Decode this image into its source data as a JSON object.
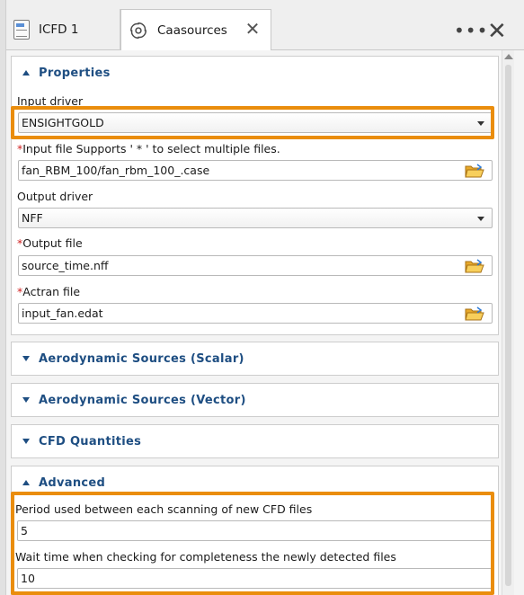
{
  "tabs": [
    {
      "label": "ICFD 1"
    },
    {
      "label": "Caasources"
    }
  ],
  "toolbar": {
    "more": "•••"
  },
  "properties": {
    "title": "Properties",
    "input_driver_label": "Input driver",
    "input_driver_value": "ENSIGHTGOLD",
    "input_file_label": "Input file Supports ' * ' to select multiple files.",
    "input_file_value": "fan_RBM_100/fan_rbm_100_.case",
    "output_driver_label": "Output driver",
    "output_driver_value": "NFF",
    "output_file_label": "Output file",
    "output_file_value": "source_time.nff",
    "actran_file_label": "Actran file",
    "actran_file_value": "input_fan.edat",
    "required_mark": "*"
  },
  "sections": {
    "aero_scalar": "Aerodynamic Sources (Scalar)",
    "aero_vector": "Aerodynamic Sources (Vector)",
    "cfd_quantities": "CFD Quantities",
    "advanced": "Advanced"
  },
  "advanced": {
    "period_label": "Period used between each scanning of new CFD files",
    "period_value": "5",
    "wait_label": "Wait time when checking for completeness the newly detected files",
    "wait_value": "10"
  },
  "colors": {
    "accent": "#1e4e82",
    "highlight": "#ea8d0c",
    "required": "#d02020"
  },
  "icons": {
    "icfd_tab": "document-icon",
    "caa_tab": "swirl-icon",
    "close": "close-icon",
    "more": "more-horizontal-icon",
    "browse": "folder-open-icon",
    "dropdown": "chevron-down-icon"
  }
}
